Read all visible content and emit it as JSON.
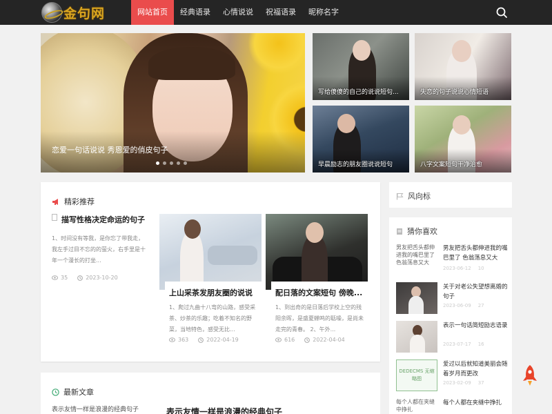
{
  "header": {
    "logo_text": "金句网",
    "nav": [
      "网站首页",
      "经典语录",
      "心情说说",
      "祝福语录",
      "昵称名字"
    ],
    "active_index": 0
  },
  "hero": {
    "caption": "恋爱一句话说说 秀恩爱的俏皮句子",
    "dots": 5,
    "active_dot": 0
  },
  "tiles": [
    {
      "caption": "写给傻傻的自己的说说短句..."
    },
    {
      "caption": "失恋的句子说说心情短语"
    },
    {
      "caption": "早晨励志的朋友圈说说短句"
    },
    {
      "caption": "八字文案短句干净治愈"
    }
  ],
  "featured": {
    "title": "精彩推荐",
    "first": {
      "title": "描写性格决定命运的句子",
      "desc": "1、时间没有等我，是你忘了带我走，我左手过目不忘的的萤火，右手里是十年一个漫长的打坐...",
      "views": "35",
      "date": "2023-10-20"
    },
    "cards": [
      {
        "title": "上山采茶发朋友圈的说说",
        "desc": "1、爬过九曲十八弯的山路，感受采茶、炒茶的乐趣；吃着不知名的野菜，当地特色，感受无比...",
        "views": "363",
        "date": "2022-04-19"
      },
      {
        "title": "配日落的文案短句 傍晚...",
        "desc": "1、到出奇的是日落后学校上空的残阳余晖，是盛夏蝉鸣的聒噪，是尚未走完的青春。 2、午外...",
        "views": "616",
        "date": "2022-04-04"
      }
    ]
  },
  "latest": {
    "title": "最新文章",
    "thumb_alt": "表示友情一样是浪漫的经典句子",
    "first_title": "表示友情一样是浪漫的经典句子"
  },
  "sidebar": {
    "wind_title": "风向标",
    "like_title": "猜你喜欢",
    "items": [
      {
        "thumb_alt": "男友把舌头都伸进我的嘴巴里了 色翁荡息又大",
        "title": "男友把舌头都伸进我的嘴巴里了 色翁荡息又大",
        "date": "2023-06-12",
        "views": "10"
      },
      {
        "thumb_alt": "",
        "title": "关于对老公失望想离婚的句子",
        "date": "2023-06-09",
        "views": "27"
      },
      {
        "thumb_alt": "",
        "title": "表示一句话简短励志语录",
        "date": "2023-07-17",
        "views": "16"
      },
      {
        "thumb_alt": "DEDECMS 无缩略图",
        "title": "爱过以后就知道美丽会随着岁月而更改",
        "date": "2023-02-09",
        "views": "37"
      },
      {
        "thumb_alt": "每个人都在夹缝中挣扎",
        "title": "每个人都在夹缝中挣扎",
        "date": "",
        "views": ""
      }
    ]
  },
  "colors": {
    "accent": "#ea4c4c",
    "header_bg": "#252525",
    "logo": "#d9a520",
    "rocket": "#e8442a"
  }
}
